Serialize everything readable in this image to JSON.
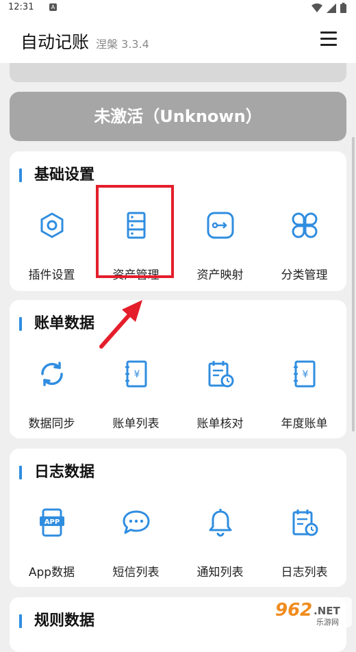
{
  "status_bar": {
    "time": "12:31",
    "badge": "A"
  },
  "app_bar": {
    "title": "自动记账",
    "version": "涅槃 3.3.4"
  },
  "activation": {
    "label": "未激活（Unknown）"
  },
  "sections": [
    {
      "title": "基础设置",
      "items": [
        {
          "label": "插件设置",
          "icon": "hexagon-plugin-icon"
        },
        {
          "label": "资产管理",
          "icon": "asset-list-icon"
        },
        {
          "label": "资产映射",
          "icon": "mapping-icon"
        },
        {
          "label": "分类管理",
          "icon": "category-clover-icon"
        }
      ]
    },
    {
      "title": "账单数据",
      "items": [
        {
          "label": "数据同步",
          "icon": "sync-icon"
        },
        {
          "label": "账单列表",
          "icon": "bill-book-icon"
        },
        {
          "label": "账单核对",
          "icon": "bill-check-icon"
        },
        {
          "label": "年度账单",
          "icon": "annual-bill-icon"
        }
      ]
    },
    {
      "title": "日志数据",
      "items": [
        {
          "label": "App数据",
          "icon": "app-data-icon"
        },
        {
          "label": "短信列表",
          "icon": "sms-bubble-icon"
        },
        {
          "label": "通知列表",
          "icon": "bell-icon"
        },
        {
          "label": "日志列表",
          "icon": "log-list-icon"
        }
      ]
    },
    {
      "title": "规则数据"
    }
  ],
  "colors": {
    "accent": "#2f8de0",
    "highlight": "#e41e2b",
    "inactive": "#a6a6a6"
  },
  "watermark": {
    "number": "962",
    "suffix": ".NET",
    "sub": "乐游网"
  }
}
